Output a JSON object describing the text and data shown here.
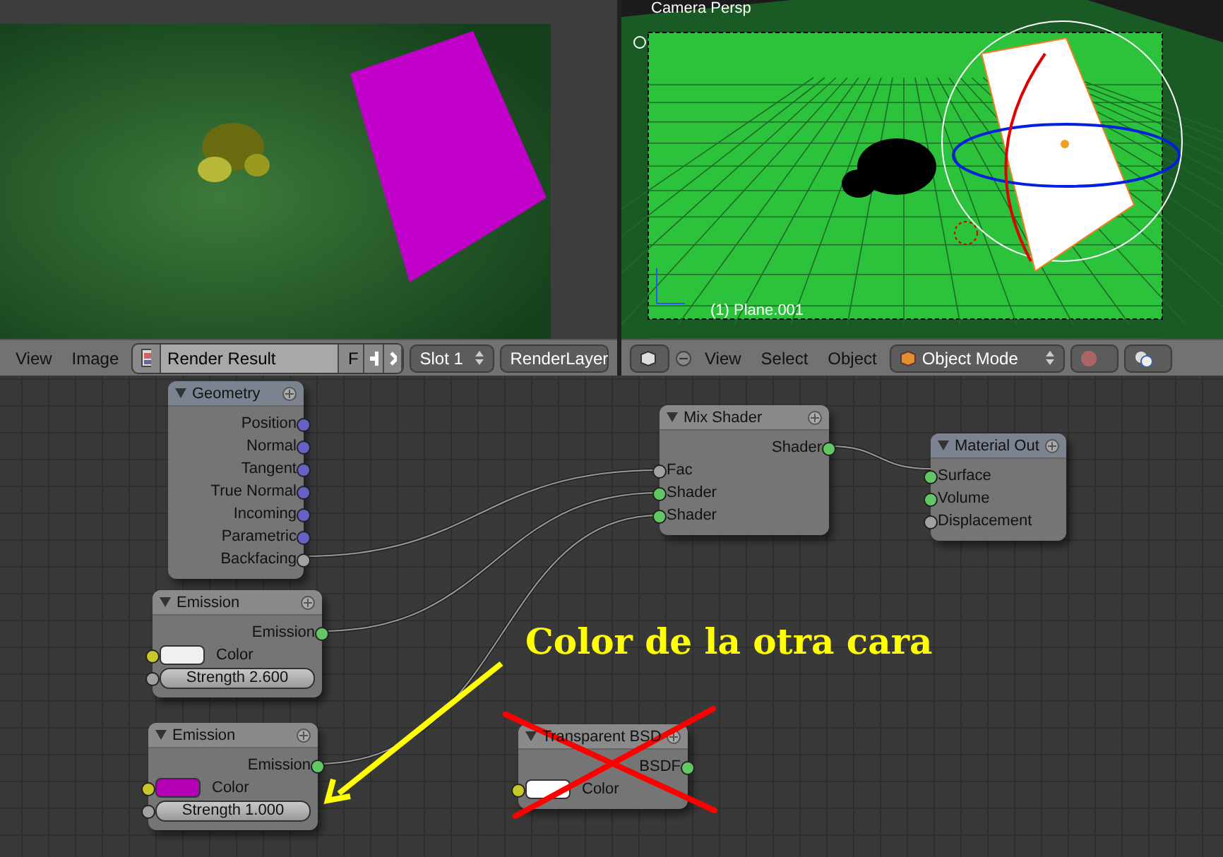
{
  "image_editor": {
    "header": {
      "menus": [
        "View",
        "Image"
      ],
      "image_name": "Render Result",
      "fake_user": "F",
      "slot": "Slot 1",
      "layer": "RenderLayer"
    }
  },
  "viewport_3d": {
    "view_label": "Camera Persp",
    "object_label": "(1) Plane.001",
    "header": {
      "menus": [
        "View",
        "Select",
        "Object"
      ],
      "mode": "Object Mode"
    }
  },
  "node_editor": {
    "nodes": [
      {
        "title": "Geometry",
        "sockets": [
          {
            "label": "Position",
            "kind": "output",
            "color": "#6363c7"
          },
          {
            "label": "Normal",
            "kind": "output",
            "color": "#6363c7"
          },
          {
            "label": "Tangent",
            "kind": "output",
            "color": "#6363c7"
          },
          {
            "label": "True Normal",
            "kind": "output",
            "color": "#6363c7"
          },
          {
            "label": "Incoming",
            "kind": "output",
            "color": "#6363c7"
          },
          {
            "label": "Parametric",
            "kind": "output",
            "color": "#6363c7"
          },
          {
            "label": "Backfacing",
            "kind": "output",
            "color": "#a1a1a1"
          }
        ]
      },
      {
        "title": "Emission",
        "sockets": [
          {
            "label": "Emission",
            "kind": "output",
            "color": "#63c763"
          },
          {
            "label": "Color",
            "kind": "color",
            "color": "#c7c729",
            "swatch": {
              "color": "#f0f0f0"
            }
          },
          {
            "label": "Strength 2.600",
            "kind": "number",
            "color": "#a1a1a1"
          }
        ]
      },
      {
        "title": "Emission",
        "sockets": [
          {
            "label": "Emission",
            "kind": "output",
            "color": "#63c763"
          },
          {
            "label": "Color",
            "kind": "color",
            "color": "#c7c729",
            "swatch": {
              "color": "#b400b4"
            }
          },
          {
            "label": "Strength 1.000",
            "kind": "number",
            "color": "#a1a1a1"
          }
        ]
      },
      {
        "title": "Mix Shader",
        "sockets": [
          {
            "label": "Shader",
            "kind": "output",
            "color": "#63c763"
          },
          {
            "label": "Fac",
            "kind": "input",
            "color": "#a1a1a1"
          },
          {
            "label": "Shader",
            "kind": "input",
            "color": "#63c763"
          },
          {
            "label": "Shader",
            "kind": "input",
            "color": "#63c763"
          }
        ]
      },
      {
        "title": "Material Out",
        "sockets": [
          {
            "label": "Surface",
            "kind": "input",
            "color": "#63c763"
          },
          {
            "label": "Volume",
            "kind": "input",
            "color": "#63c763"
          },
          {
            "label": "Displacement",
            "kind": "input",
            "color": "#a1a1a1"
          }
        ]
      },
      {
        "title": "Transparent BSD",
        "sockets": [
          {
            "label": "BSDF",
            "kind": "output",
            "color": "#63c763"
          },
          {
            "label": "Color",
            "kind": "color",
            "color": "#c7c729",
            "swatch": {
              "color": "#ffffff"
            }
          }
        ]
      }
    ],
    "annotation": "Color de la otra cara"
  }
}
